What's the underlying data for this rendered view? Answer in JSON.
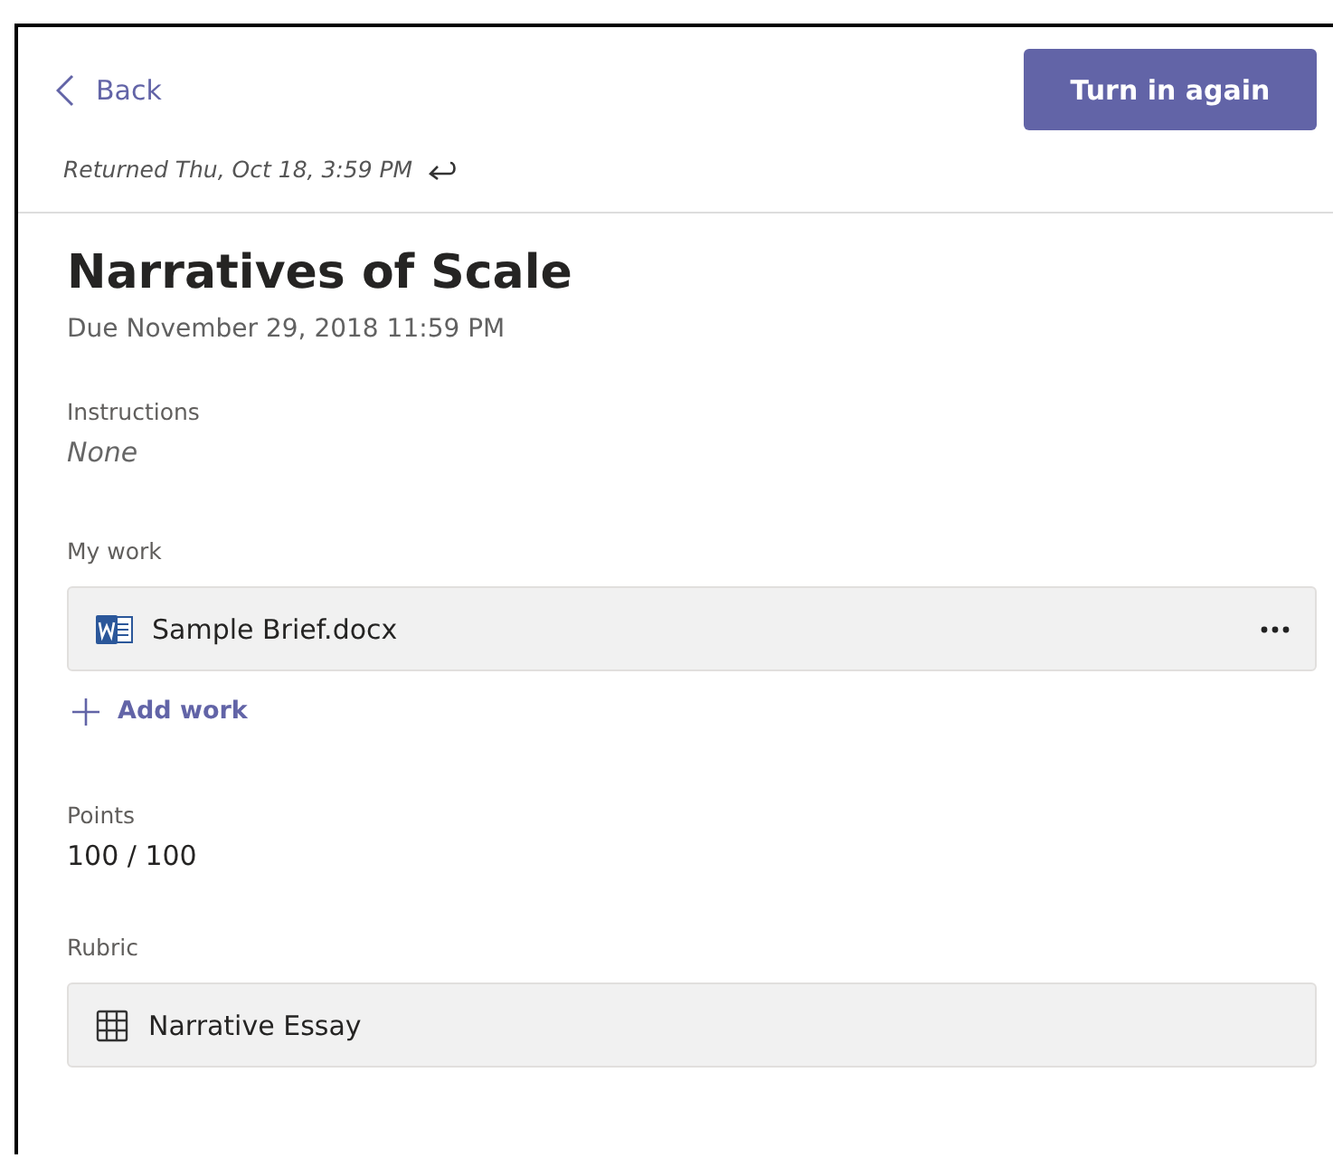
{
  "header": {
    "back": "Back",
    "primary_button": "Turn in again",
    "returned": "Returned Thu, Oct 18, 3:59 PM"
  },
  "assignment": {
    "title": "Narratives of Scale",
    "due": "Due November 29, 2018 11:59 PM"
  },
  "instructions": {
    "label": "Instructions",
    "value": "None"
  },
  "my_work": {
    "label": "My work",
    "files": [
      {
        "name": "Sample Brief.docx",
        "kind": "word"
      }
    ],
    "add": "Add work"
  },
  "points": {
    "label": "Points",
    "value": "100 / 100"
  },
  "rubric": {
    "label": "Rubric",
    "items": [
      {
        "name": "Narrative Essay",
        "kind": "grid"
      }
    ]
  }
}
